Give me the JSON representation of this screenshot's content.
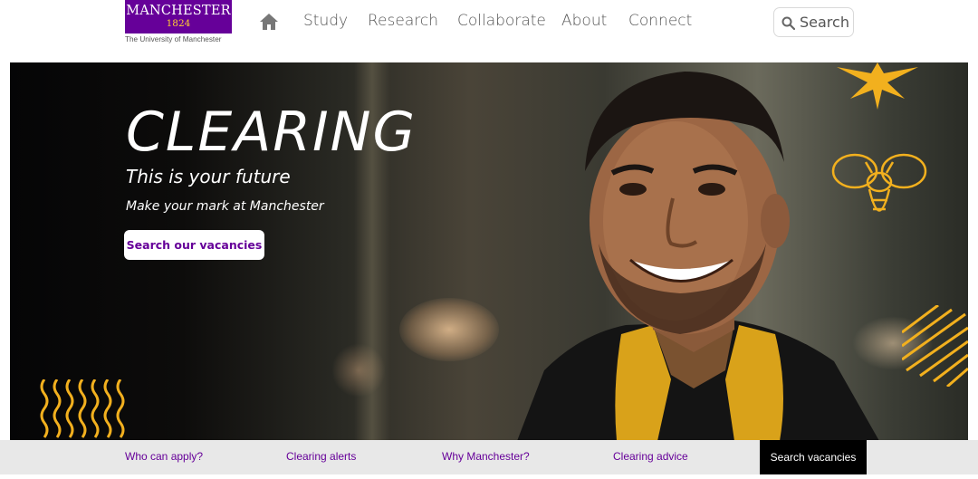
{
  "header": {
    "logo": {
      "word": "MANCHESTER",
      "year": "1824",
      "subtitle": "The University of Manchester"
    },
    "home_icon": "home-icon",
    "nav": [
      "Study",
      "Research",
      "Collaborate",
      "About",
      "Connect"
    ],
    "search_label": "Search"
  },
  "hero": {
    "title": "CLEARING",
    "subtitle": "This is your future",
    "tagline": "Make your mark at Manchester",
    "cta_label": "Search our vacancies"
  },
  "subnav": {
    "items": [
      "Who can apply?",
      "Clearing alerts",
      "Why Manchester?",
      "Clearing advice"
    ],
    "active_label": "Search vacancies"
  },
  "colors": {
    "brand_purple": "#660099",
    "accent_gold": "#ffcc33",
    "subnav_bg": "#e8e8e8"
  }
}
